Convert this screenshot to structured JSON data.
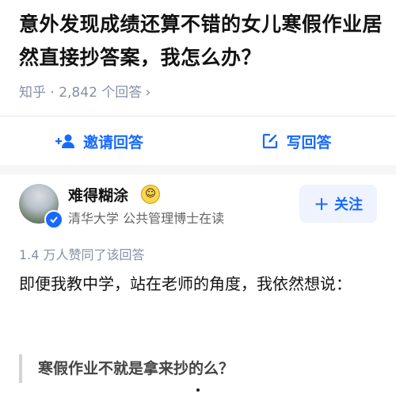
{
  "question": {
    "title": "意外发现成绩还算不错的女儿寒假作业居然直接抄答案，我怎么办？",
    "meta": "知乎 · 2,842 个回答"
  },
  "actions": {
    "invite_label": "邀请回答",
    "write_label": "写回答"
  },
  "author": {
    "name": "难得糊涂",
    "description": "清华大学 公共管理博士在读",
    "follow_label": "关注"
  },
  "answer": {
    "likes": "1.4 万人赞同了该回答",
    "paragraph": "即便我教中学，站在老师的角度，我依然想说：",
    "quote": "寒假作业不就是拿来抄的么？"
  },
  "colors": {
    "accent": "#1769ff",
    "meta_gray": "#8590a6"
  }
}
